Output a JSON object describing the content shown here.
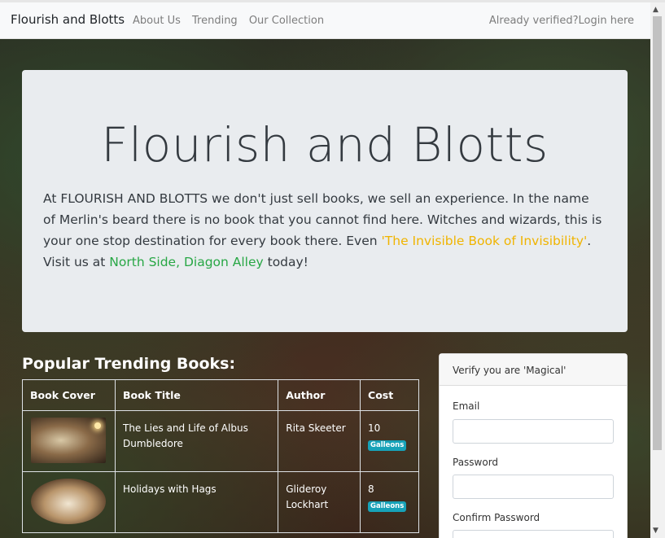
{
  "navbar": {
    "brand": "Flourish and Blotts",
    "links": [
      "About Us",
      "Trending",
      "Our Collection"
    ],
    "login": "Already verified?Login here"
  },
  "jumbotron": {
    "title": "Flourish and Blotts",
    "text_part1": "At FLOURISH AND BLOTTS we don't just sell books, we sell an experience. In the name of Merlin's beard there is no book that you cannot find here. Witches and wizards, this is your one stop destination for every book there. Even ",
    "highlight_book": "'The Invisible Book of Invisibility'",
    "text_part2": ". Visit us at ",
    "highlight_location": "North Side, Diagon Alley",
    "text_part3": " today!"
  },
  "trending": {
    "title": "Popular Trending Books:",
    "headers": [
      "Book Cover",
      "Book Title",
      "Author",
      "Cost"
    ],
    "rows": [
      {
        "title": "The Lies and Life of Albus Dumbledore",
        "author": "Rita Skeeter",
        "cost": "10",
        "currency": "Galleons"
      },
      {
        "title": "Holidays with Hags",
        "author": "Glideroy Lockhart",
        "cost": "8",
        "currency": "Galleons"
      }
    ]
  },
  "verify_form": {
    "header": "Verify you are 'Magical'",
    "email_label": "Email",
    "password_label": "Password",
    "confirm_label": "Confirm Password"
  },
  "colors": {
    "highlight_yellow": "#f0b400",
    "highlight_green": "#28a745",
    "badge": "#17a2b8"
  },
  "icons": [
    "scroll-up-arrow-icon",
    "scroll-down-arrow-icon"
  ]
}
